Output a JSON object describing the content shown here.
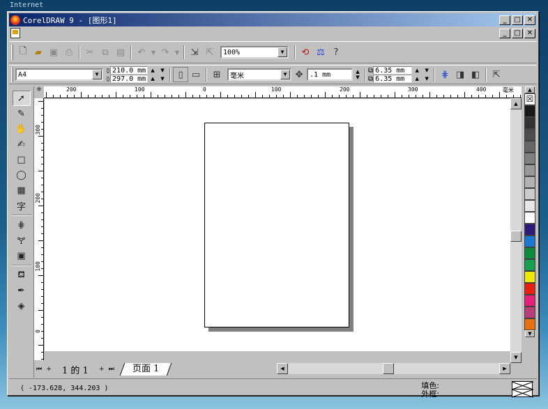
{
  "desktop": {
    "label": "Internet"
  },
  "window": {
    "title": "CorelDRAW 9 - [图形1]",
    "title_buttons": [
      "_",
      "□",
      "✕"
    ]
  },
  "toolbar": {
    "zoom": "100%"
  },
  "property_bar": {
    "paper_size": "A4",
    "width": "210.0 mm",
    "height": "297.0 mm",
    "units": "毫米",
    "nudge": ".1 mm",
    "dup_x": "6.35 mm",
    "dup_y": "6.35 mm"
  },
  "ruler": {
    "h_labels": [
      "200",
      "100",
      "0",
      "100",
      "200",
      "300",
      "400"
    ],
    "unit": "毫米",
    "v_labels": [
      "300",
      "200",
      "100",
      "0"
    ]
  },
  "page_nav": {
    "count": "1 的 1",
    "tab": "页面 1"
  },
  "palette": {
    "colors": [
      "#1a1a1a",
      "#333333",
      "#4d4d4d",
      "#666666",
      "#808080",
      "#999999",
      "#b3b3b3",
      "#cccccc",
      "#e6e6e6",
      "#ffffff",
      "#2e1a78",
      "#1a78d0",
      "#0a8a3a",
      "#14a050",
      "#f0e800",
      "#e82010",
      "#e8207a",
      "#b8407a",
      "#e87010"
    ]
  },
  "status": {
    "coords": "( -173.628, 344.203 )",
    "fill_label": "填色:",
    "outline_label": "外框:"
  }
}
